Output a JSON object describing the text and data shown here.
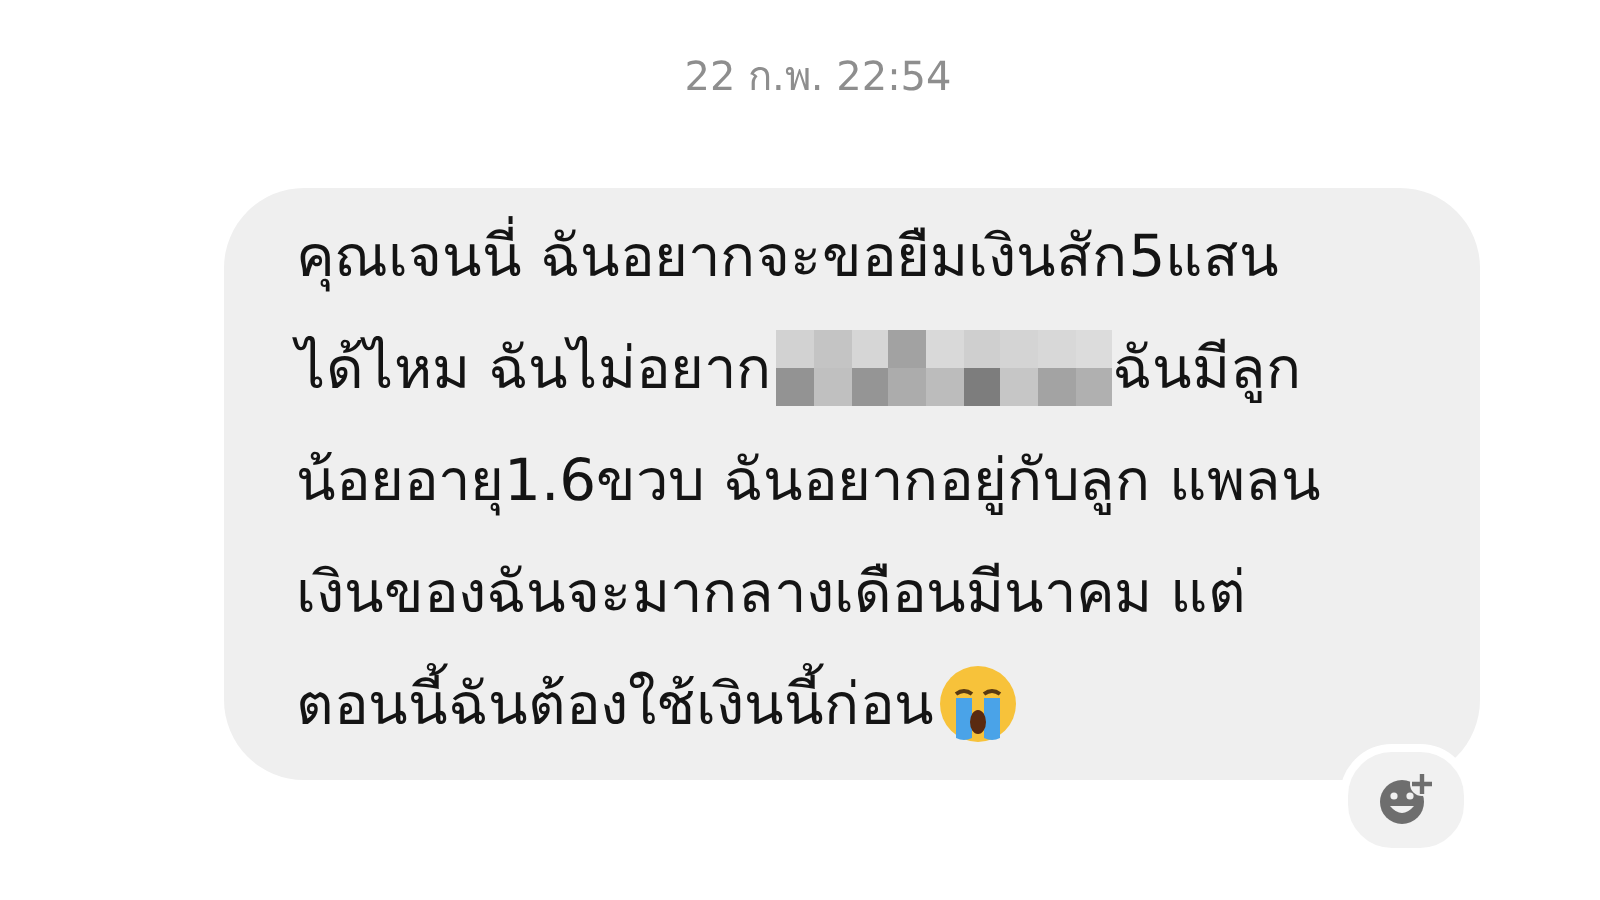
{
  "timestamp": "22 ก.พ. 22:54",
  "message": {
    "lines": [
      [
        {
          "kind": "text",
          "text": "คุณเจนนี่ ฉันอยากจะขอยืมเงินสัก5แสน"
        }
      ],
      [
        {
          "kind": "text",
          "text": "ได้ไหม ฉันไม่อยาก"
        },
        {
          "kind": "redacted"
        },
        {
          "kind": "text",
          "text": " ฉันมีลูก"
        }
      ],
      [
        {
          "kind": "text",
          "text": "น้อยอายุ1.6ขวบ ฉันอยากอยู่กับลูก แพลน"
        }
      ],
      [
        {
          "kind": "text",
          "text": "เงินของฉันจะมากลางเดือนมีนาคม แต่"
        }
      ],
      [
        {
          "kind": "text",
          "text": "ตอนนี้ฉันต้องใช้เงินนี้ก่อน"
        },
        {
          "kind": "emoji"
        }
      ]
    ]
  }
}
